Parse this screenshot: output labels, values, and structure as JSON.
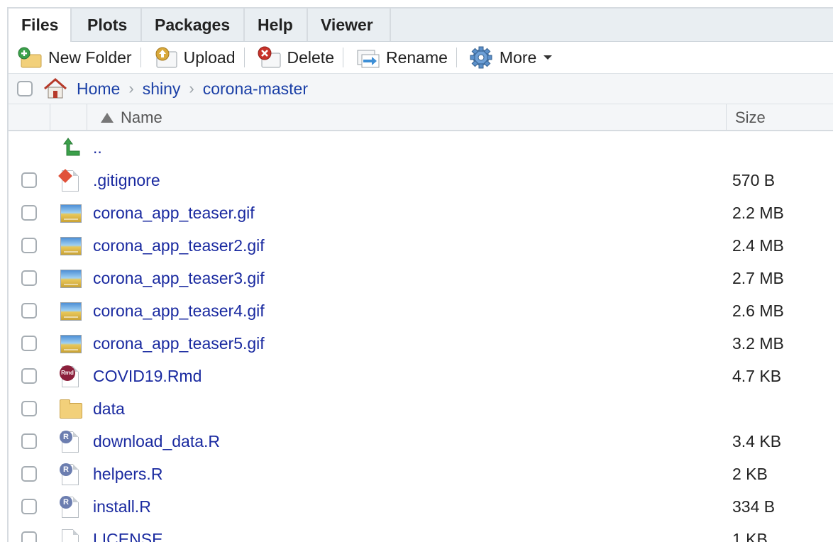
{
  "tabs": [
    {
      "label": "Files",
      "active": true
    },
    {
      "label": "Plots",
      "active": false
    },
    {
      "label": "Packages",
      "active": false
    },
    {
      "label": "Help",
      "active": false
    },
    {
      "label": "Viewer",
      "active": false
    }
  ],
  "toolbar": {
    "new_folder": "New Folder",
    "upload": "Upload",
    "delete": "Delete",
    "rename": "Rename",
    "more": "More"
  },
  "breadcrumb": {
    "items": [
      "Home",
      "shiny",
      "corona-master"
    ]
  },
  "columns": {
    "name": "Name",
    "size": "Size"
  },
  "parent_link": "..",
  "files": [
    {
      "name": ".gitignore",
      "size": "570 B",
      "icon": "git-file-icon"
    },
    {
      "name": "corona_app_teaser.gif",
      "size": "2.2 MB",
      "icon": "image-file-icon"
    },
    {
      "name": "corona_app_teaser2.gif",
      "size": "2.4 MB",
      "icon": "image-file-icon"
    },
    {
      "name": "corona_app_teaser3.gif",
      "size": "2.7 MB",
      "icon": "image-file-icon"
    },
    {
      "name": "corona_app_teaser4.gif",
      "size": "2.6 MB",
      "icon": "image-file-icon"
    },
    {
      "name": "corona_app_teaser5.gif",
      "size": "3.2 MB",
      "icon": "image-file-icon"
    },
    {
      "name": "COVID19.Rmd",
      "size": "4.7 KB",
      "icon": "rmd-file-icon"
    },
    {
      "name": "data",
      "size": "",
      "icon": "folder-icon"
    },
    {
      "name": "download_data.R",
      "size": "3.4 KB",
      "icon": "r-file-icon"
    },
    {
      "name": "helpers.R",
      "size": "2 KB",
      "icon": "r-file-icon"
    },
    {
      "name": "install.R",
      "size": "334 B",
      "icon": "r-file-icon"
    },
    {
      "name": "LICENSE",
      "size": "1 KB",
      "icon": "text-file-icon"
    }
  ],
  "colors": {
    "link": "#1a2aa0",
    "tabbar": "#e9eef2",
    "header": "#f4f6f8"
  }
}
